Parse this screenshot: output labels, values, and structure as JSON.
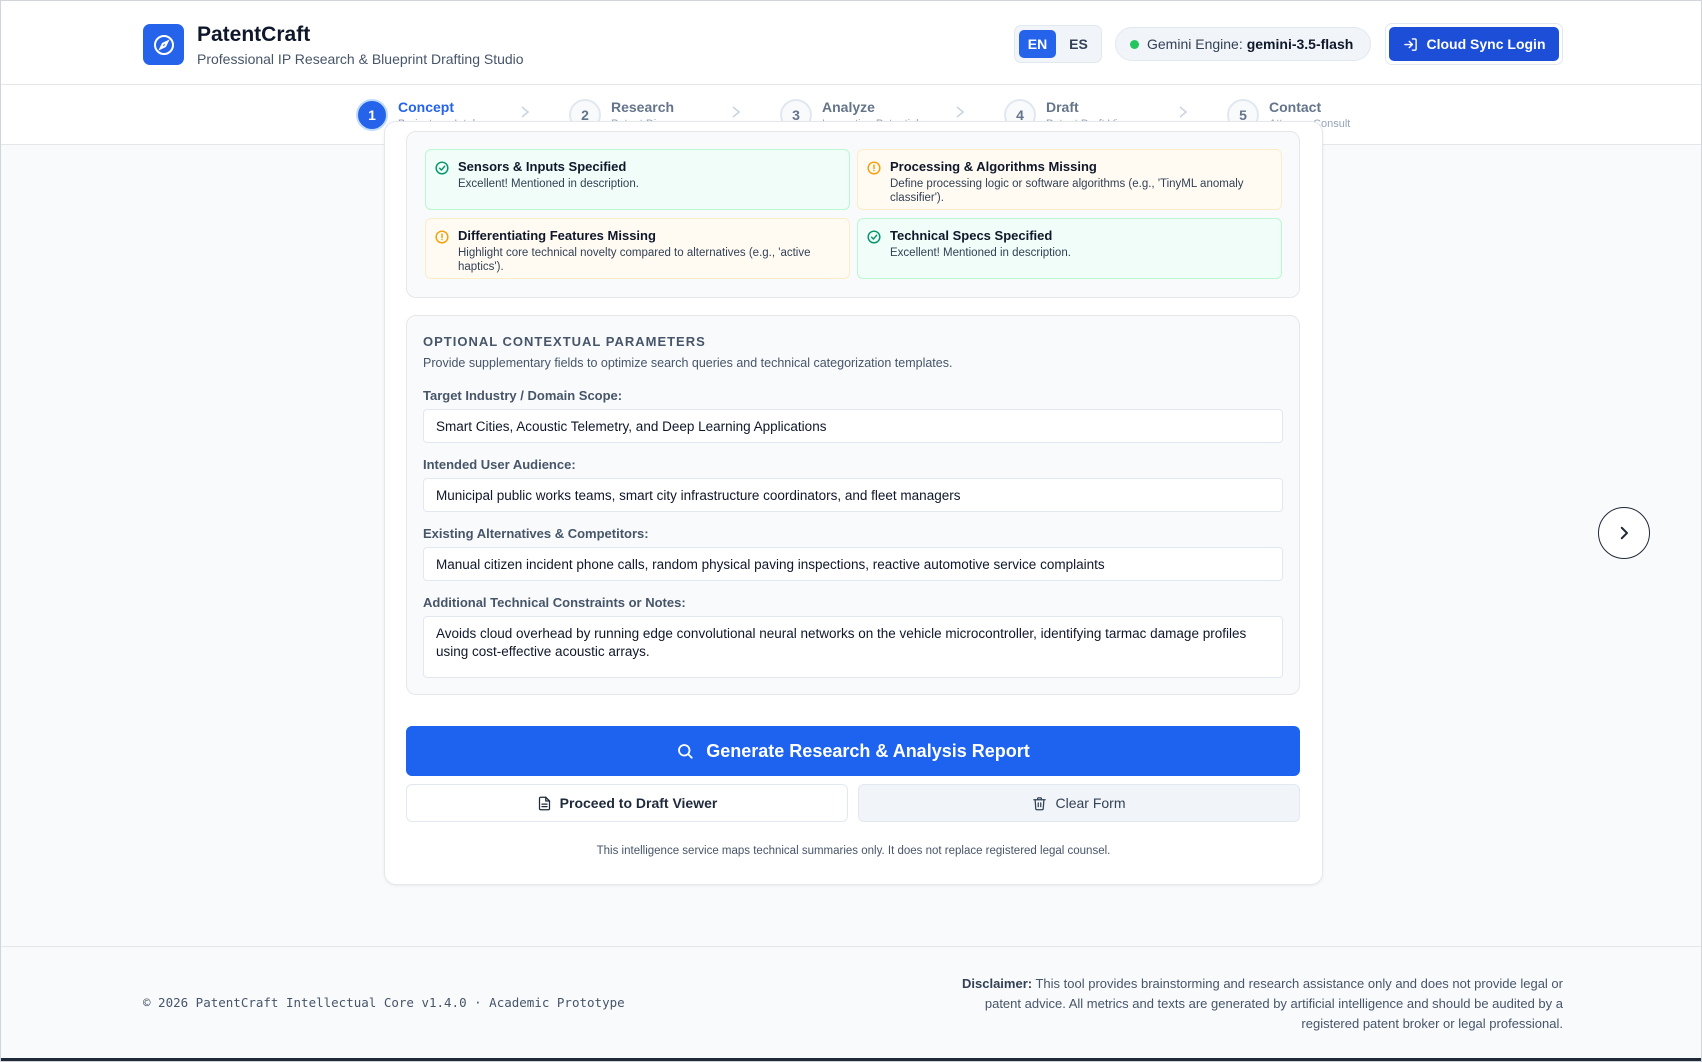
{
  "header": {
    "brand_title": "PatentCraft",
    "brand_subtitle": "Professional IP Research & Blueprint Drafting Studio",
    "languages": [
      "EN",
      "ES"
    ],
    "active_language": "EN",
    "engine_label": "Gemini Engine:",
    "engine_model": "gemini-3.5-flash",
    "login_label": "Cloud Sync Login",
    "accent_color": "#2563eb"
  },
  "stepper": [
    {
      "num": "1",
      "title": "Concept",
      "subtitle": "Brainstorm Intake",
      "active": true
    },
    {
      "num": "2",
      "title": "Research",
      "subtitle": "Patent Discovery",
      "active": false
    },
    {
      "num": "3",
      "title": "Analyze",
      "subtitle": "Innovation Potential",
      "active": false
    },
    {
      "num": "4",
      "title": "Draft",
      "subtitle": "Patent Draft Viewer",
      "active": false
    },
    {
      "num": "5",
      "title": "Contact",
      "subtitle": "Attorney Consult",
      "active": false
    }
  ],
  "checks": [
    {
      "status": "ok",
      "title": "Sensors & Inputs Specified",
      "desc": "Excellent! Mentioned in description."
    },
    {
      "status": "warn",
      "title": "Processing & Algorithms Missing",
      "desc": "Define processing logic or software algorithms (e.g., 'TinyML anomaly classifier')."
    },
    {
      "status": "warn",
      "title": "Differentiating Features Missing",
      "desc": "Highlight core technical novelty compared to alternatives (e.g., 'active haptics')."
    },
    {
      "status": "ok",
      "title": "Technical Specs Specified",
      "desc": "Excellent! Mentioned in description."
    }
  ],
  "params": {
    "title": "OPTIONAL CONTEXTUAL PARAMETERS",
    "description": "Provide supplementary fields to optimize search queries and technical categorization templates.",
    "fields": [
      {
        "label": "Target Industry / Domain Scope:",
        "value": "Smart Cities, Acoustic Telemetry, and Deep Learning Applications"
      },
      {
        "label": "Intended User Audience:",
        "value": "Municipal public works teams, smart city infrastructure coordinators, and fleet managers"
      },
      {
        "label": "Existing Alternatives & Competitors:",
        "value": "Manual citizen incident phone calls, random physical paving inspections, reactive automotive service complaints"
      },
      {
        "label": "Additional Technical Constraints or Notes:",
        "value": "Avoids cloud overhead by running edge convolutional neural networks on the vehicle microcontroller, identifying tarmac damage profiles using cost-effective acoustic arrays."
      }
    ]
  },
  "actions": {
    "generate_label": "Generate Research & Analysis Report",
    "draft_label": "Proceed to Draft Viewer",
    "clear_label": "Clear Form"
  },
  "card_note": "This intelligence service maps technical summaries only. It does not replace registered legal counsel.",
  "footer": {
    "copyright": "© 2026 PatentCraft Intellectual Core v1.4.0 · Academic Prototype",
    "disclaimer_label": "Disclaimer:",
    "disclaimer_text": " This tool provides brainstorming and research assistance only and does not provide legal or patent advice. All metrics and texts are generated by artificial intelligence and should be audited by a registered patent broker or legal professional."
  }
}
